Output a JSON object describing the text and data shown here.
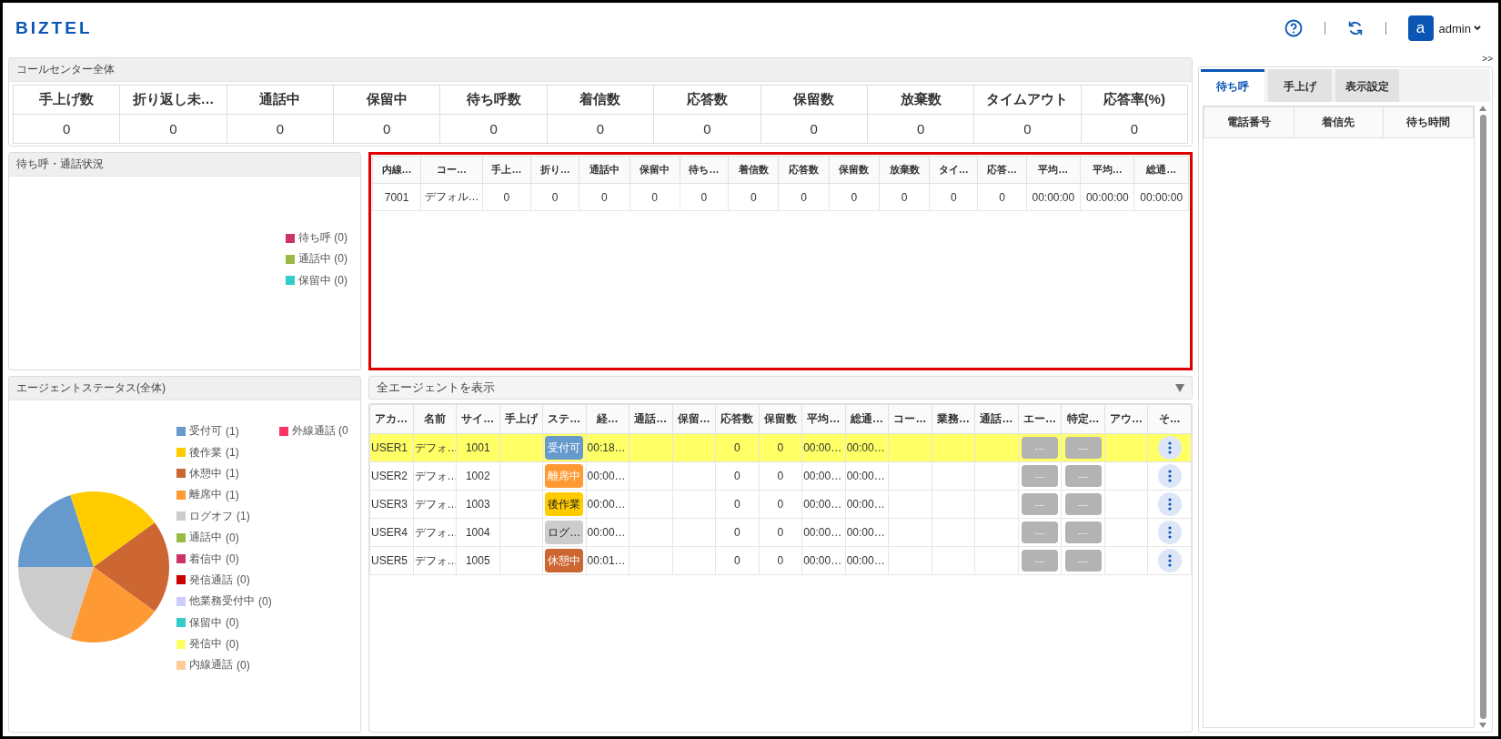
{
  "header": {
    "logo": "BIZTEL",
    "avatar_letter": "a",
    "user": "admin",
    "collapse": ">>"
  },
  "call_center": {
    "title": "コールセンター全体",
    "columns": [
      "手上げ数",
      "折り返し未…",
      "通話中",
      "保留中",
      "待ち呼数",
      "着信数",
      "応答数",
      "保留数",
      "放棄数",
      "タイムアウト",
      "応答率(%)"
    ],
    "values": [
      "0",
      "0",
      "0",
      "0",
      "0",
      "0",
      "0",
      "0",
      "0",
      "0",
      "0"
    ]
  },
  "queue_panel": {
    "title": "待ち呼・通話状況",
    "legend": [
      {
        "label": "待ち呼 (0)",
        "color": "#cc3366"
      },
      {
        "label": "通話中 (0)",
        "color": "#99bb44"
      },
      {
        "label": "保留中 (0)",
        "color": "#33cccc"
      }
    ]
  },
  "queue_table": {
    "highlighted": true,
    "columns": [
      "内線…",
      "コー…",
      "手上…",
      "折り…",
      "通話中",
      "保留中",
      "待ち…",
      "着信数",
      "応答数",
      "保留数",
      "放棄数",
      "タイ…",
      "応答…",
      "平均…",
      "平均…",
      "総通…"
    ],
    "rows": [
      [
        "7001",
        "デフォル…",
        "0",
        "0",
        "0",
        "0",
        "0",
        "0",
        "0",
        "0",
        "0",
        "0",
        "0",
        "00:00:00",
        "00:00:00",
        "00:00:00"
      ]
    ]
  },
  "agent_status": {
    "title": "エージェントステータス(全体)",
    "legend": [
      {
        "count": "(1)",
        "color": "#6699cc"
      },
      {
        "count": "(1)",
        "color": "#ffcc00"
      },
      {
        "count": "(1)",
        "color": "#cc6633"
      },
      {
        "count": "(1)",
        "color": "#ff9933"
      },
      {
        "count": "(1)",
        "color": "#cccccc"
      },
      {
        "count": "(0)",
        "color": "#99bb44"
      },
      {
        "count": "(0)",
        "color": "#cc3366"
      },
      {
        "count": "(0)",
        "color": "#cc0000"
      },
      {
        "count": "(0)",
        "color": "#ccccff"
      },
      {
        "count": "(0)",
        "color": "#33cccc"
      },
      {
        "count": "(0)",
        "color": "#ffff66"
      },
      {
        "count": "(0)",
        "color": "#ffcc99"
      }
    ],
    "legend_extra": {
      "label": "外線通話 (0",
      "color": "#ff3366"
    },
    "chart_data": {
      "type": "pie",
      "categories": [
        "受付可",
        "後作業",
        "休憩中",
        "離席中",
        "ログオフ",
        "通話中",
        "着信中",
        "発信通話",
        "他業務受付中",
        "保留中",
        "発信中",
        "内線通話"
      ],
      "values": [
        20,
        20,
        20,
        20,
        20,
        0,
        0,
        0,
        0,
        0,
        0,
        0
      ]
    }
  },
  "agents": {
    "filter": "全エージェントを表示",
    "columns": [
      "アカ…",
      "名前",
      "サイ…",
      "手上げ",
      "ステ…",
      "経…",
      "通話…",
      "保留…",
      "応答数",
      "保留数",
      "平均…",
      "総通…",
      "コー…",
      "業務…",
      "通話…",
      "エー…",
      "特定…",
      "アウ…",
      "そ…"
    ],
    "rows": [
      {
        "selected": true,
        "account": "USER1",
        "name": "デフォ…",
        "seat": "1001",
        "status": {
          "label": "受付可",
          "color": "#6699cc"
        },
        "elapsed": "00:18…",
        "answered": "0",
        "held": "0",
        "average": "00:00…",
        "total": "00:00…",
        "button_1": "---",
        "button_2": "---"
      },
      {
        "selected": false,
        "account": "USER2",
        "name": "デフォ…",
        "seat": "1002",
        "status": {
          "label": "離席中",
          "color": "#ff9933"
        },
        "elapsed": "00:00…",
        "answered": "0",
        "held": "0",
        "average": "00:00…",
        "total": "00:00…",
        "button_1": "---",
        "button_2": "---"
      },
      {
        "selected": false,
        "account": "USER3",
        "name": "デフォ…",
        "seat": "1003",
        "status": {
          "label": "後作業",
          "color": "#ffcc00"
        },
        "elapsed": "00:00…",
        "answered": "0",
        "held": "0",
        "average": "00:00…",
        "total": "00:00…",
        "button_1": "---",
        "button_2": "---"
      },
      {
        "selected": false,
        "account": "USER4",
        "name": "デフォ…",
        "seat": "1004",
        "status": {
          "label": "ログ…",
          "color": "#cccccc"
        },
        "elapsed": "00:00…",
        "answered": "0",
        "held": "0",
        "average": "00:00…",
        "total": "00:00…",
        "button_1": "---",
        "button_2": "---"
      },
      {
        "selected": false,
        "account": "USER5",
        "name": "デフォ…",
        "seat": "1005",
        "status": {
          "label": "休憩中",
          "color": "#cc6633"
        },
        "elapsed": "00:01…",
        "answered": "0",
        "held": "0",
        "average": "00:00…",
        "total": "00:00…",
        "button_1": "---",
        "button_2": "---"
      }
    ]
  },
  "side_panel": {
    "tabs": [
      {
        "label": "待ち呼",
        "selected": true
      },
      {
        "label": "手上げ",
        "selected": false
      },
      {
        "label": "表示設定",
        "selected": false
      }
    ],
    "columns": [
      "電話番号",
      "着信先",
      "待ち時間"
    ]
  }
}
